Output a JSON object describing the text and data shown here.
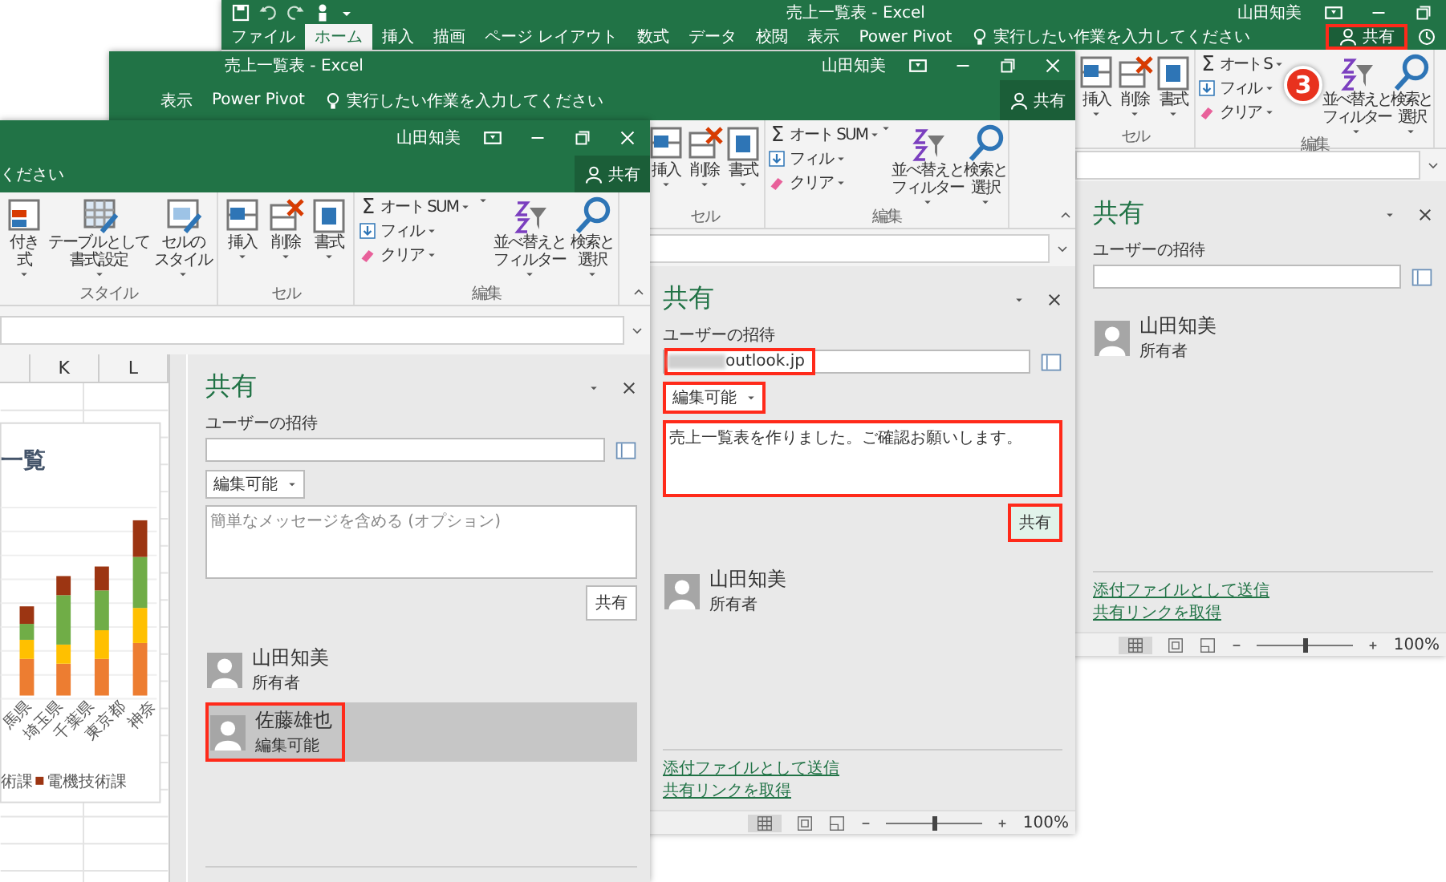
{
  "back_window": {
    "title": "売上一覧表 - Excel",
    "user": "山田知美",
    "quick_access": [
      {
        "kind": "save"
      },
      {
        "kind": "undo"
      },
      {
        "kind": "redo"
      },
      {
        "kind": "touch"
      },
      {
        "kind": "customize"
      }
    ],
    "controls": [
      {
        "kind": "ribbon"
      },
      {
        "kind": "minimize"
      },
      {
        "kind": "restore"
      }
    ],
    "tabs": [
      {
        "label": "ファイル",
        "selected": false
      },
      {
        "label": "ホーム",
        "selected": true
      },
      {
        "label": "挿入",
        "selected": false
      },
      {
        "label": "描画",
        "selected": false
      },
      {
        "label": "ページ レイアウト",
        "selected": false
      },
      {
        "label": "数式",
        "selected": false
      },
      {
        "label": "データ",
        "selected": false
      },
      {
        "label": "校閲",
        "selected": false
      },
      {
        "label": "表示",
        "selected": false
      },
      {
        "label": "Power Pivot",
        "selected": false
      }
    ],
    "tell_me": {
      "text": "実行したい作業を入力してください",
      "bulb": true
    },
    "share": {
      "label": "共有",
      "highlighted": true
    },
    "history": true,
    "step_badge": "3",
    "ribbon": {
      "groups": [
        {
          "label": "セル",
          "items": [
            {
              "kind": "insert",
              "lines": [
                "挿入"
              ]
            },
            {
              "kind": "delete",
              "lines": [
                "削除"
              ]
            },
            {
              "kind": "format",
              "lines": [
                "書式"
              ]
            }
          ]
        },
        {
          "label": "編集",
          "items": [
            {
              "kind": "stack",
              "items": [
                {
                  "kind": "sum",
                  "symbol": "Σ",
                  "label": "オート S"
                },
                {
                  "kind": "fill",
                  "label": "フィル"
                },
                {
                  "kind": "clear",
                  "label": "クリア"
                }
              ]
            },
            {
              "kind": "sort",
              "lines": [
                "並べ替えと",
                "フィルター"
              ]
            },
            {
              "kind": "search",
              "lines": [
                "検索と",
                "選択"
              ]
            }
          ]
        }
      ]
    },
    "pane": {
      "title": "共有",
      "invite_label": "ユーザーの招待",
      "people": [
        {
          "name": "山田知美",
          "role": "所有者",
          "selected": false,
          "highlighted": false
        }
      ],
      "links": [
        "添付ファイルとして送信",
        "共有リンクを取得"
      ]
    },
    "status_bar": {
      "zoom": "100%",
      "slider": {
        "level": 0.5
      }
    }
  },
  "middle_window": {
    "title": "売上一覧表 - Excel",
    "user": "山田知美",
    "controls": [
      {
        "kind": "ribbon"
      },
      {
        "kind": "minimize"
      },
      {
        "kind": "restore"
      },
      {
        "kind": "close"
      }
    ],
    "tabs": [
      {
        "label": "表示",
        "selected": false
      },
      {
        "label": "Power Pivot",
        "selected": false
      }
    ],
    "tell_me": {
      "text": "実行したい作業を入力してください",
      "bulb": true
    },
    "share": {
      "label": "共有",
      "highlighted": false
    },
    "ribbon": {
      "groups": [
        {
          "label": "セル",
          "items": [
            {
              "kind": "insert",
              "lines": [
                "挿入"
              ]
            },
            {
              "kind": "delete",
              "lines": [
                "削除"
              ]
            },
            {
              "kind": "format",
              "lines": [
                "書式"
              ]
            }
          ]
        },
        {
          "label": "編集",
          "items": [
            {
              "kind": "stack",
              "items": [
                {
                  "kind": "sum",
                  "symbol": "Σ",
                  "label": "オート SUM"
                },
                {
                  "kind": "fill",
                  "label": "フィル"
                },
                {
                  "kind": "clear",
                  "label": "クリア"
                }
              ]
            },
            {
              "kind": "sort",
              "lines": [
                "並べ替えと",
                "フィルター"
              ]
            },
            {
              "kind": "search",
              "lines": [
                "検索と",
                "選択"
              ]
            }
          ]
        }
      ]
    },
    "pane": {
      "title": "共有",
      "invite_label": "ユーザーの招待",
      "invite_value": "outlook.jp",
      "invite_blurred": true,
      "invite_highlighted": true,
      "permission": "編集可能",
      "permission_highlighted": true,
      "message": "売上一覧表を作りました。ご確認お願いします。",
      "message_highlighted": true,
      "share_button": {
        "label": "共有",
        "highlighted": true
      },
      "people": [
        {
          "name": "山田知美",
          "role": "所有者",
          "selected": false,
          "highlighted": false
        }
      ],
      "links": [
        "添付ファイルとして送信",
        "共有リンクを取得"
      ]
    },
    "status_bar": {
      "zoom": "100%",
      "slider": {
        "level": 0.5
      }
    }
  },
  "front_window": {
    "user": "山田知美",
    "controls": [
      {
        "kind": "ribbon"
      },
      {
        "kind": "minimize"
      },
      {
        "kind": "restore"
      },
      {
        "kind": "close"
      }
    ],
    "tell_me": {
      "text": "ください",
      "bulb": false
    },
    "share": {
      "label": "共有",
      "highlighted": false
    },
    "ribbon": {
      "groups": [
        {
          "label": "スタイル",
          "items": [
            {
              "kind": "conditional",
              "lines": [
                "付き",
                "式"
              ]
            },
            {
              "kind": "table",
              "lines": [
                "テーブルとして",
                "書式設定"
              ]
            },
            {
              "kind": "cellstyle",
              "lines": [
                "セルの",
                "スタイル"
              ]
            }
          ]
        },
        {
          "label": "セル",
          "items": [
            {
              "kind": "insert",
              "lines": [
                "挿入"
              ]
            },
            {
              "kind": "delete",
              "lines": [
                "削除"
              ]
            },
            {
              "kind": "format",
              "lines": [
                "書式"
              ]
            }
          ]
        },
        {
          "label": "編集",
          "items": [
            {
              "kind": "stack",
              "items": [
                {
                  "kind": "sum",
                  "symbol": "Σ",
                  "label": "オート SUM"
                },
                {
                  "kind": "fill",
                  "label": "フィル"
                },
                {
                  "kind": "clear",
                  "label": "クリア"
                }
              ]
            },
            {
              "kind": "sort",
              "lines": [
                "並べ替えと",
                "フィルター"
              ]
            },
            {
              "kind": "search",
              "lines": [
                "検索と",
                "選択"
              ]
            }
          ]
        }
      ]
    },
    "sheet": {
      "columns": [
        "K",
        "L"
      ],
      "chart_title": "一覧",
      "categories": [
        "馬県",
        "埼玉県",
        "千葉県",
        "東京都",
        "神奈"
      ],
      "legend": [
        {
          "label": "術課"
        },
        {
          "label": "電機技術課",
          "color": "#9c3512"
        }
      ]
    },
    "pane": {
      "title": "共有",
      "invite_label": "ユーザーの招待",
      "permission": "編集可能",
      "permission_highlighted": false,
      "message_placeholder": "簡単なメッセージを含める (オプション)",
      "message_highlighted": false,
      "share_button": {
        "label": "共有",
        "highlighted": false
      },
      "people": [
        {
          "name": "山田知美",
          "role": "所有者",
          "selected": false,
          "highlighted": false
        },
        {
          "name": "佐藤雄也",
          "role": "編集可能",
          "selected": true,
          "highlighted": true
        }
      ]
    }
  }
}
